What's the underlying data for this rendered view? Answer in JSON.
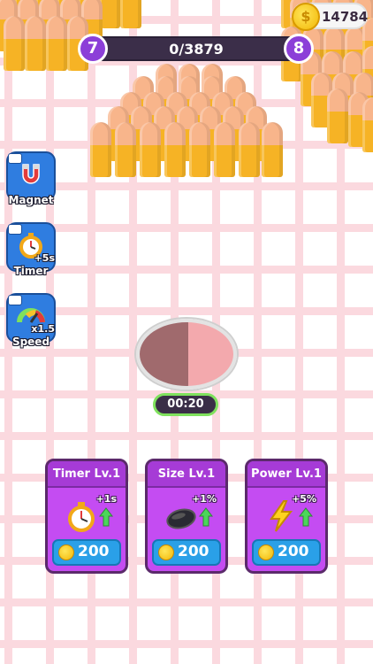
{
  "hud": {
    "level_current": "7",
    "level_next": "8",
    "progress_text": "0/3879",
    "coins": "14784"
  },
  "powerups": [
    {
      "label": "Magnet",
      "mult": "",
      "icon": "magnet-icon"
    },
    {
      "label": "Timer",
      "mult": "+5s",
      "icon": "stopwatch-icon"
    },
    {
      "label": "Speed",
      "mult": "x1.5",
      "icon": "speedometer-icon"
    }
  ],
  "hole": {
    "timer": "00:20"
  },
  "upgrades": [
    {
      "title": "Timer Lv.1",
      "bonus": "+1s",
      "price": "200",
      "icon": "stopwatch-icon"
    },
    {
      "title": "Size Lv.1",
      "bonus": "+1%",
      "price": "200",
      "icon": "hole-icon"
    },
    {
      "title": "Power Lv.1",
      "bonus": "+5%",
      "price": "200",
      "icon": "lightning-icon"
    }
  ],
  "colors": {
    "grid": "#fbd9df",
    "bullet_tip": "#f8b58b",
    "bullet_casing": "#f6b325",
    "level_badge": "#8c3fd8",
    "card": "#c44cf2",
    "price_button": "#2aa0e8",
    "timer_border": "#7fe15d"
  }
}
